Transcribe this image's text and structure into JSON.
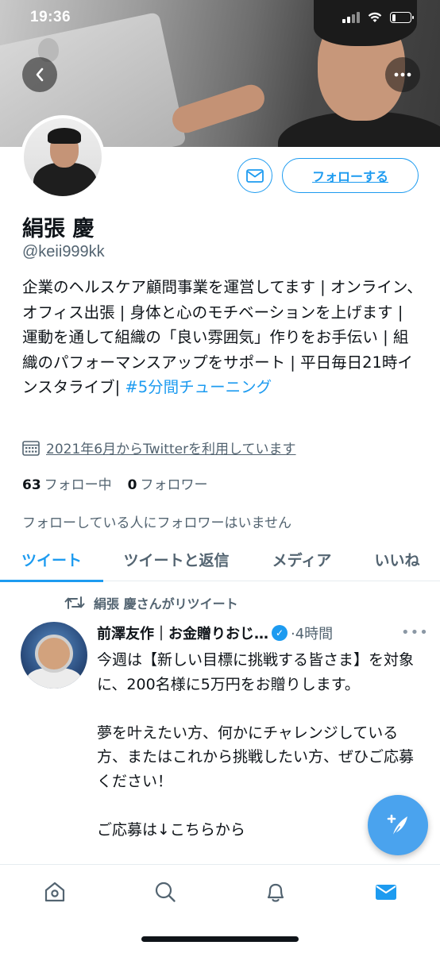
{
  "status_bar": {
    "time": "19:36",
    "battery_level": 0.2
  },
  "profile": {
    "name": "絹張 慶",
    "handle": "@keii999kk",
    "follow_label": "フォローする",
    "bio_text": "企業のヘルスケア顧問事業を運営してます | オンライン、オフィス出張 | 身体と心のモチベーションを上げます | 運動を通して組織の「良い雰囲気」作りをお手伝い | 組織のパフォーマンスアップをサポート | 平日毎日21時インスタライブ| ",
    "bio_hashtag": "#5分間チューニング",
    "joined": "2021年6月からTwitterを利用しています",
    "following_count": "63",
    "following_label": "フォロー中",
    "followers_count": "0",
    "followers_label": "フォロワー",
    "no_followers_note": "フォローしている人にフォロワーはいません"
  },
  "tabs": [
    {
      "label": "ツイート",
      "active": true
    },
    {
      "label": "ツイートと返信",
      "active": false
    },
    {
      "label": "メディア",
      "active": false
    },
    {
      "label": "いいね",
      "active": false
    }
  ],
  "tweet": {
    "retweet_note": "絹張 慶さんがリツイート",
    "author": "前澤友作｜お金贈りおじ…",
    "time": "·4時間",
    "body": "今週は【新しい目標に挑戦する皆さま】を対象に、200名様に5万円をお贈りします。\n\n夢を叶えたい方、何かにチャレンジしている方、またはこれから挑戦したい方、ぜひご応募ください！\n\nご応募は↓こちらから"
  },
  "icons": {
    "back": "chevron-left-icon",
    "more": "more-horizontal-icon",
    "message": "mail-icon",
    "calendar": "calendar-icon",
    "retweet": "retweet-icon",
    "verified": "verified-badge-icon",
    "compose": "compose-tweet-icon",
    "nav": [
      "home-icon",
      "search-icon",
      "notifications-icon",
      "messages-icon"
    ]
  },
  "colors": {
    "accent": "#1d9bf0",
    "secondary_text": "#536471",
    "primary_text": "#0f1419"
  }
}
